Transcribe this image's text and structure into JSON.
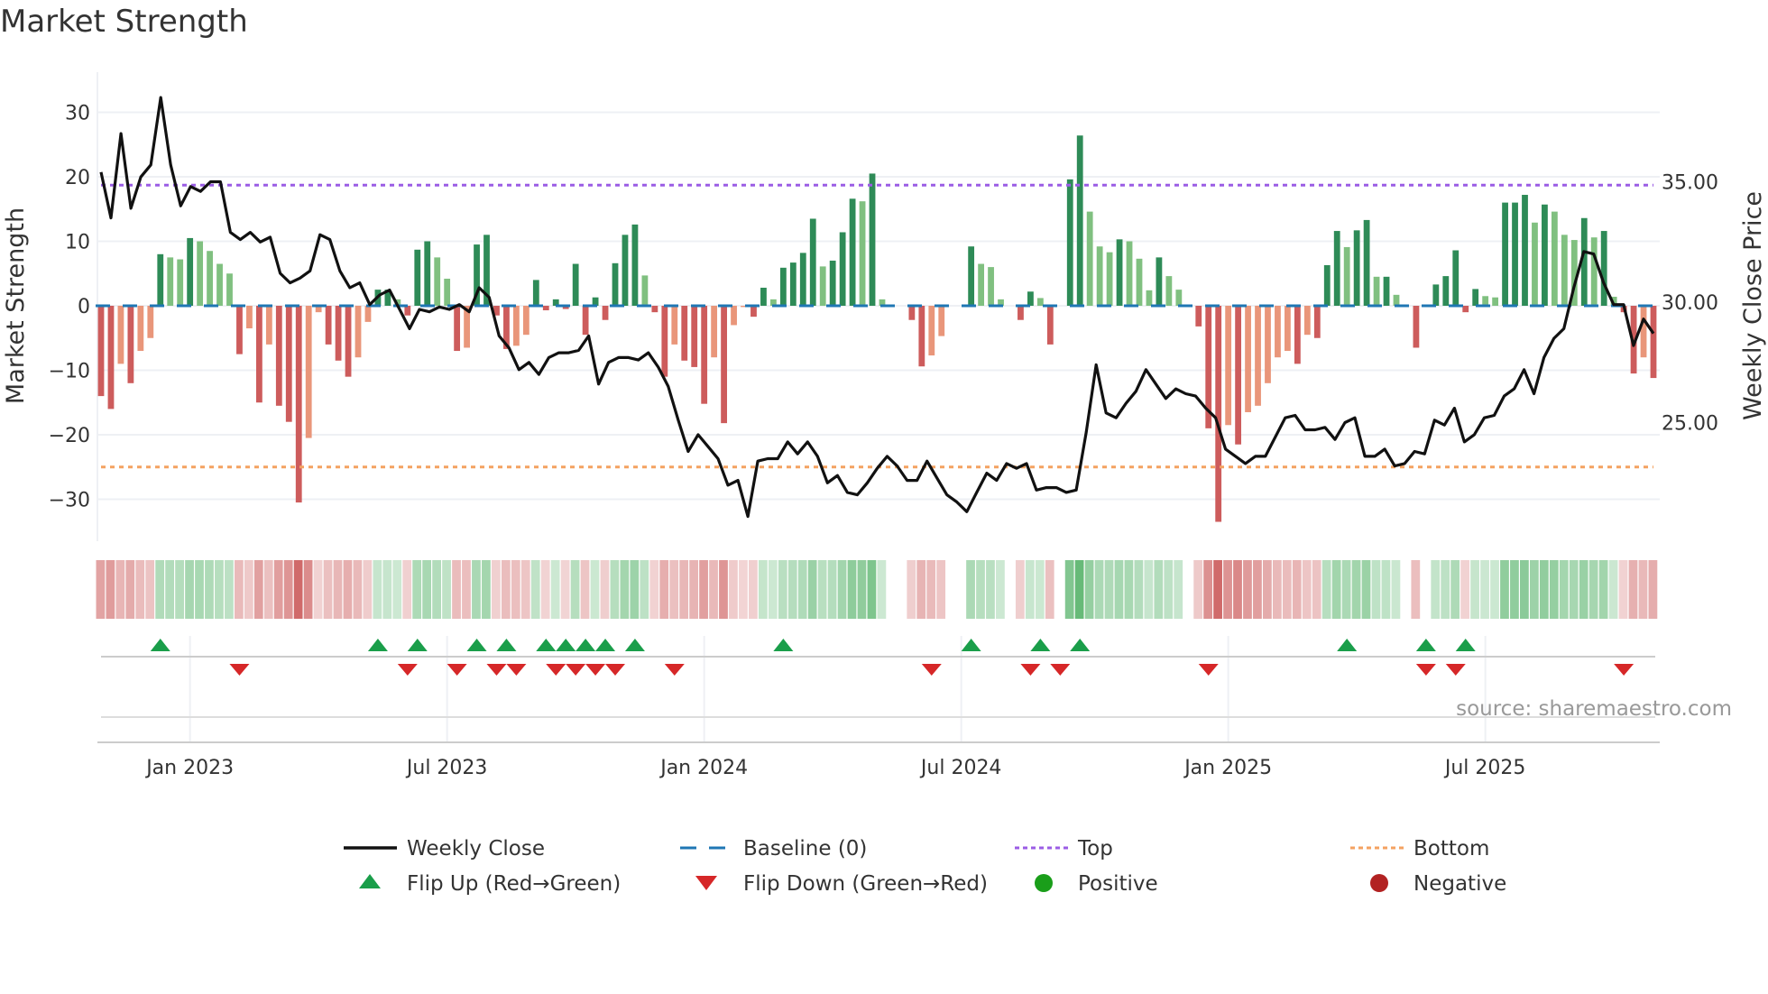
{
  "title": "Market Strength",
  "source": "source: sharemaestro.com",
  "chart_data": {
    "type": "bar",
    "title": "Market Strength",
    "ylabel": "Market Strength",
    "y2label": "Weekly Close Price",
    "ylim": [
      -38,
      38
    ],
    "y2lim": [
      20.3,
      40
    ],
    "yticks": [
      30,
      20,
      10,
      0,
      -10,
      -20,
      -30
    ],
    "yticklabels": [
      "30",
      "20",
      "10",
      "0",
      "−10",
      "−20",
      "−30"
    ],
    "y2ticks": [
      35,
      30,
      25
    ],
    "y2ticklabels": [
      "35.00",
      "30.00",
      "25.00"
    ],
    "top_level": 18.7,
    "bottom_level": -25,
    "xticks": [
      {
        "week": 9,
        "label": "Jan 2023"
      },
      {
        "week": 35,
        "label": "Jul 2023"
      },
      {
        "week": 61,
        "label": "Jan 2024"
      },
      {
        "week": 87,
        "label": "Jul 2024"
      },
      {
        "week": 114,
        "label": "Jan 2025"
      },
      {
        "week": 140,
        "label": "Jul 2025"
      }
    ],
    "strength": [
      -14,
      -16,
      -9,
      -12,
      -7,
      -5,
      8,
      7.5,
      7.2,
      10.5,
      10,
      8.5,
      6.5,
      5,
      -7.5,
      -3.5,
      -15,
      -6,
      -15.5,
      -18,
      -30.5,
      -20.5,
      -1,
      -6,
      -8.5,
      -11,
      -8,
      -2.5,
      2.5,
      2.5,
      1,
      -1.5,
      8.7,
      10,
      7.5,
      4.2,
      -7,
      -6.5,
      9.5,
      11,
      -1.5,
      -6.7,
      -6.2,
      -4.5,
      4,
      -0.7,
      1,
      -0.5,
      6.5,
      -4.5,
      1.3,
      -2.2,
      6.6,
      11,
      12.6,
      4.7,
      -1,
      -11,
      -6,
      -8.5,
      -9.5,
      -15.2,
      -8,
      -18.2,
      -3,
      -0.2,
      -1.7,
      2.8,
      1,
      5.9,
      6.7,
      8.2,
      13.5,
      6.1,
      7,
      11.4,
      16.6,
      16.2,
      20.5,
      1,
      0,
      0,
      -2.2,
      -9.4,
      -7.7,
      -4.7,
      0,
      0,
      9.2,
      6.5,
      6,
      1,
      0,
      -2.2,
      2.2,
      1.2,
      -6,
      0,
      19.6,
      26.4,
      14.6,
      9.2,
      8.3,
      10.3,
      10,
      7.3,
      2.4,
      7.5,
      4.6,
      2.5,
      0,
      -3.2,
      -19,
      -33.5,
      -18.5,
      -21.5,
      -16.5,
      -15.5,
      -12,
      -8,
      -7,
      -9,
      -4.5,
      -5,
      6.3,
      11.6,
      9.1,
      11.7,
      13.3,
      4.5,
      4.5,
      1.7,
      0,
      -6.5,
      0,
      3.3,
      4.6,
      8.6,
      -1,
      2.6,
      1.5,
      1.3,
      16,
      16,
      17.2,
      12.9,
      15.7,
      14.6,
      11,
      10.2,
      13.6,
      10.6,
      11.6,
      1.4,
      -1,
      -10.5,
      -8,
      -11.2
    ],
    "weekly_close": [
      35.4,
      33.5,
      37.0,
      33.9,
      35.2,
      35.7,
      38.5,
      35.7,
      34.0,
      34.8,
      34.6,
      35.0,
      35.0,
      32.9,
      32.6,
      32.9,
      32.5,
      32.7,
      31.2,
      30.8,
      31.0,
      31.3,
      32.8,
      32.6,
      31.3,
      30.6,
      30.8,
      29.9,
      30.3,
      30.5,
      29.7,
      28.9,
      29.7,
      29.6,
      29.8,
      29.7,
      29.9,
      29.6,
      30.6,
      30.2,
      28.6,
      28.1,
      27.2,
      27.5,
      27.0,
      27.7,
      27.9,
      27.9,
      28.0,
      28.6,
      26.6,
      27.5,
      27.7,
      27.7,
      27.6,
      27.9,
      27.3,
      26.5,
      25.1,
      23.8,
      24.5,
      24.0,
      23.5,
      22.4,
      22.6,
      21.1,
      23.4,
      23.5,
      23.5,
      24.2,
      23.7,
      24.2,
      23.6,
      22.5,
      22.8,
      22.1,
      22.0,
      22.5,
      23.1,
      23.6,
      23.2,
      22.6,
      22.6,
      23.4,
      22.7,
      22.0,
      21.7,
      21.3,
      22.1,
      22.9,
      22.6,
      23.3,
      23.1,
      23.3,
      22.2,
      22.3,
      22.3,
      22.1,
      22.2,
      24.6,
      27.4,
      25.4,
      25.2,
      25.8,
      26.3,
      27.2,
      26.6,
      26.0,
      26.4,
      26.2,
      26.1,
      25.6,
      25.2,
      23.9,
      23.6,
      23.3,
      23.6,
      23.6,
      24.4,
      25.2,
      25.3,
      24.7,
      24.7,
      24.8,
      24.3,
      25.0,
      25.2,
      23.6,
      23.6,
      23.9,
      23.2,
      23.3,
      23.8,
      23.7,
      25.1,
      24.9,
      25.6,
      24.2,
      24.5,
      25.2,
      25.3,
      26.1,
      26.4,
      27.2,
      26.2,
      27.7,
      28.5,
      28.9,
      30.6,
      32.1,
      32.0,
      30.8,
      29.9,
      29.9,
      28.2,
      29.3,
      28.7
    ],
    "flip_up_weeks": [
      6,
      28,
      32,
      38,
      41,
      45,
      47,
      49,
      51,
      54,
      69,
      88,
      95,
      99,
      126,
      134,
      138
    ],
    "flip_down_weeks": [
      14,
      31,
      36,
      40,
      42,
      46,
      48,
      50,
      52,
      58,
      84,
      94,
      97,
      112,
      134,
      137,
      154
    ],
    "legend": [
      {
        "key": "close",
        "label": "Weekly Close"
      },
      {
        "key": "baseline",
        "label": "Baseline (0)"
      },
      {
        "key": "top",
        "label": "Top"
      },
      {
        "key": "bottom",
        "label": "Bottom"
      },
      {
        "key": "flip_up",
        "label": "Flip Up (Red→Green)"
      },
      {
        "key": "flip_down",
        "label": "Flip Down (Green→Red)"
      },
      {
        "key": "positive",
        "label": "Positive"
      },
      {
        "key": "negative",
        "label": "Negative"
      }
    ],
    "legend_placement": "bottom",
    "grid": true
  },
  "colors": {
    "pos_strong": "#2e8b57",
    "pos_weak": "#80c080",
    "neg_strong": "#cd5c5c",
    "neg_weak": "#e9967a",
    "close": "#111111",
    "baseline": "#1f77b4",
    "top": "#9b5de5",
    "bottom": "#f4a261",
    "flip_up": "#1a9e4a",
    "flip_down": "#d62728",
    "positive": "#1a9e1a",
    "negative": "#b22222"
  }
}
